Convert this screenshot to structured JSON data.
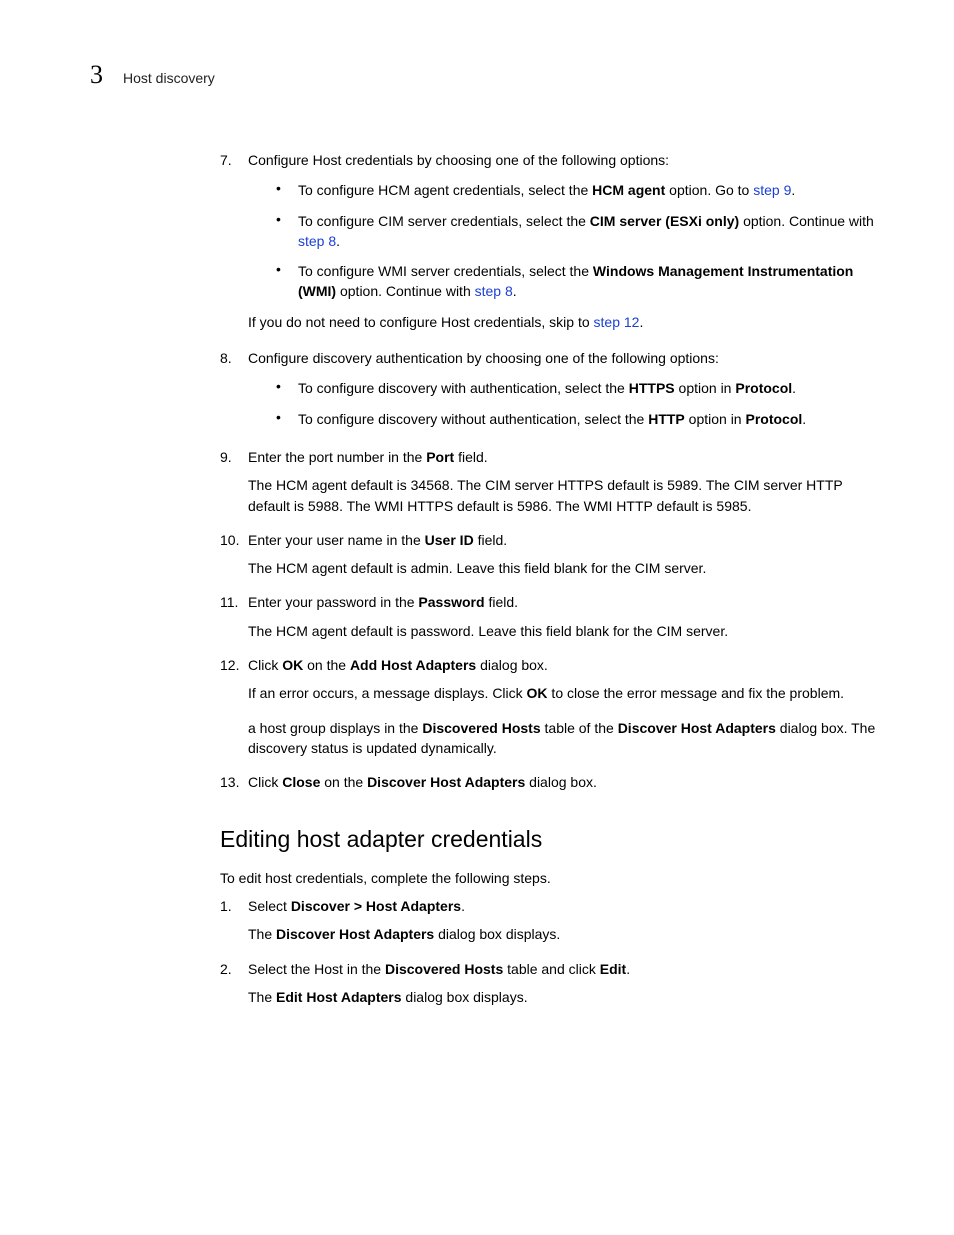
{
  "header": {
    "chapter_number": "3",
    "chapter_title": "Host discovery"
  },
  "step7": {
    "num": "7.",
    "text": "Configure Host credentials by choosing one of the following options:",
    "b1_pre": "To configure HCM agent credentials, select the ",
    "b1_bold": "HCM agent",
    "b1_mid": " option. Go to ",
    "b1_link": "step 9",
    "b1_end": ".",
    "b2_pre": "To configure CIM server credentials, select the ",
    "b2_bold": "CIM server (ESXi only)",
    "b2_mid": " option. Continue with ",
    "b2_link": "step 8",
    "b2_end": ".",
    "b3_pre": "To configure WMI server credentials, select the ",
    "b3_bold": "Windows Management Instrumentation (WMI)",
    "b3_mid": " option. Continue with ",
    "b3_link": "step 8",
    "b3_end": ".",
    "note_pre": "If you do not need to configure Host credentials, skip to ",
    "note_link": "step 12",
    "note_end": "."
  },
  "step8": {
    "num": "8.",
    "text": "Configure discovery authentication by choosing one of the following options:",
    "b1_pre": "To configure discovery with authentication, select the ",
    "b1_bold1": "HTTPS",
    "b1_mid": " option in ",
    "b1_bold2": "Protocol",
    "b1_end": ".",
    "b2_pre": "To configure discovery without authentication, select the ",
    "b2_bold1": "HTTP",
    "b2_mid": " option in ",
    "b2_bold2": "Protocol",
    "b2_end": "."
  },
  "step9": {
    "num": "9.",
    "pre": "Enter the port number in the ",
    "bold": "Port",
    "post": " field.",
    "detail": "The HCM agent default is 34568. The CIM server HTTPS default is 5989. The CIM server HTTP default is 5988. The WMI HTTPS default is 5986. The WMI HTTP default is 5985."
  },
  "step10": {
    "num": "10.",
    "pre": "Enter your user name in the ",
    "bold": "User ID",
    "post": " field.",
    "detail": "The HCM agent default is admin. Leave this field blank for the CIM server."
  },
  "step11": {
    "num": "11.",
    "pre": "Enter your password in the ",
    "bold": "Password",
    "post": " field.",
    "detail": "The HCM agent default is password. Leave this field blank for the CIM server."
  },
  "step12": {
    "num": "12.",
    "pre": "Click ",
    "bold1": "OK",
    "mid1": " on the ",
    "bold2": "Add Host Adapters",
    "post": " dialog box.",
    "d1_pre": "If an error occurs, a message displays. Click ",
    "d1_bold": "OK",
    "d1_post": " to close the error message and fix the problem.",
    "d2_pre": "a host group displays in the ",
    "d2_bold1": "Discovered Hosts",
    "d2_mid": " table of the ",
    "d2_bold2": "Discover Host Adapters",
    "d2_post": " dialog box. The discovery status is updated dynamically."
  },
  "step13": {
    "num": "13.",
    "pre": "Click ",
    "bold1": "Close",
    "mid": " on the ",
    "bold2": "Discover Host Adapters",
    "post": " dialog box."
  },
  "section2": {
    "title": "Editing host adapter credentials",
    "intro": "To edit host credentials, complete the following steps.",
    "s1_num": "1.",
    "s1_pre": "Select ",
    "s1_bold": "Discover > Host Adapters",
    "s1_post": ".",
    "s1_d_pre": "The ",
    "s1_d_bold": "Discover Host Adapters",
    "s1_d_post": " dialog box displays.",
    "s2_num": "2.",
    "s2_pre": "Select the Host in the ",
    "s2_bold1": "Discovered Hosts",
    "s2_mid": " table and click ",
    "s2_bold2": "Edit",
    "s2_post": ".",
    "s2_d_pre": "The ",
    "s2_d_bold": "Edit Host Adapters",
    "s2_d_post": " dialog box displays."
  }
}
